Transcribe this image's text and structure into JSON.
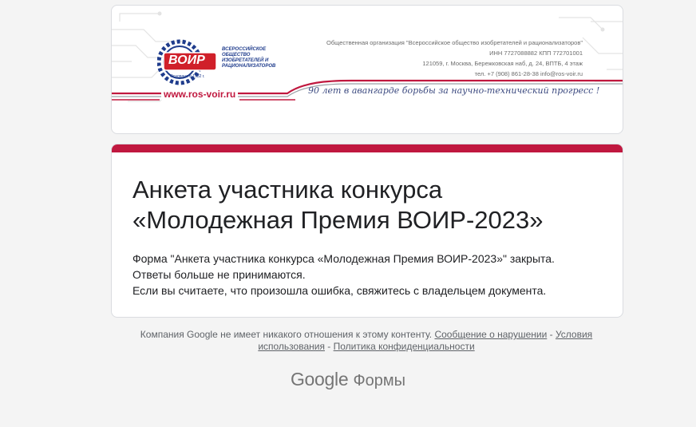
{
  "banner": {
    "logo_text": "ВОИР",
    "logo_sub": "Основано в 1932 г.",
    "org_name_lines": [
      "ВСЕРОССИЙСКОЕ",
      "ОБЩЕСТВО",
      "ИЗОБРЕТАТЕЛЕЙ И",
      "РАЦИОНАЛИЗАТОРОВ"
    ],
    "org_full": "Общественная организация \"Всероссийское общество изобретателей и рационализаторов\"",
    "inn": "ИНН 7727088882    КПП 772701001",
    "address": "121059, г. Москва, Бережковская наб, д. 24, ВПТБ, 4 этаж",
    "contacts": "тел. +7 (908) 861-28-38     info@ros-voir.ru",
    "website": "www.ros-voir.ru",
    "slogan": "90 лет в авангарде борьбы за научно-технический прогресс !"
  },
  "form": {
    "title_line1": "Анкета участника конкурса",
    "title_line2": "«Молодежная Премия ВОИР-2023»",
    "message_line1": "Форма \"Анкета участника конкурса «Молодежная Премия ВОИР-2023»\" закрыта.",
    "message_line2": "Ответы больше не принимаются.",
    "message_line3": "Если вы считаете, что произошла ошибка, свяжитесь с владельцем документа."
  },
  "footer": {
    "disclaimer": "Компания Google не имеет никакого отношения к этому контенту.",
    "report_link": "Сообщение о нарушении",
    "terms_link": "Условия использования",
    "privacy_link": "Политика конфиденциальности",
    "separator": " - "
  },
  "branding": {
    "google": "Google",
    "product": "Формы"
  },
  "colors": {
    "accent": "#c0183f",
    "logo_blue": "#1f3c8c",
    "logo_red": "#d0202a",
    "background": "#f4f4f4"
  }
}
